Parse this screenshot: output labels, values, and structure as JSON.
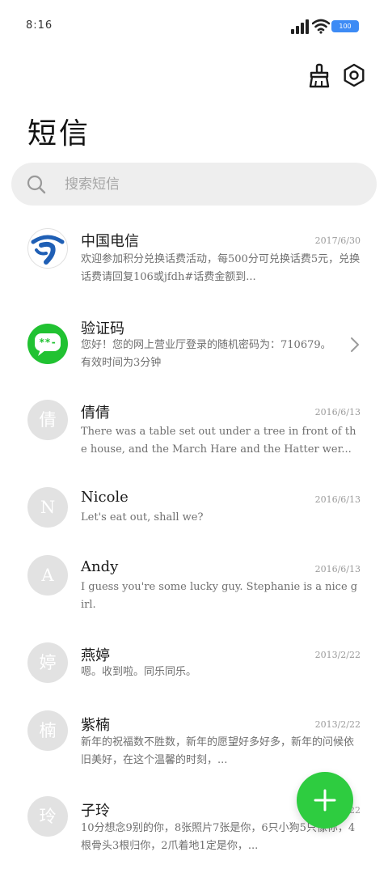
{
  "status_bar": {
    "time": "8:16",
    "battery": "100"
  },
  "header": {
    "title": "短信"
  },
  "search": {
    "placeholder": "搜索短信"
  },
  "messages": [
    {
      "name": "中国电信",
      "date": "2017/6/30",
      "preview": "欢迎参加积分兑换话费活动，每500分可兑换话费5元，兑换话费请回复106或jfdh#话费金额到...",
      "avatar_type": "logo-telecom"
    },
    {
      "name": "验证码",
      "date": "",
      "preview": "您好！您的网上营业厅登录的随机密码为：710679。有效时间为3分钟",
      "avatar_type": "logo-code",
      "avatar_text": "**-"
    },
    {
      "name": "倩倩",
      "date": "2016/6/13",
      "preview": "There was a table set out under a tree in front of the house, and the March Hare and the Hatter wer...",
      "avatar_text": "倩"
    },
    {
      "name": "Nicole",
      "date": "2016/6/13",
      "preview": "Let's eat out, shall we?",
      "avatar_text": "N"
    },
    {
      "name": "Andy",
      "date": "2016/6/13",
      "preview": "I guess you're some lucky guy. Stephanie is a nice girl.",
      "avatar_text": "A"
    },
    {
      "name": "燕婷",
      "date": "2013/2/22",
      "preview": "嗯。收到啦。同乐同乐。",
      "avatar_text": "婷"
    },
    {
      "name": "紫楠",
      "date": "2013/2/22",
      "preview": "新年的祝福数不胜数，新年的愿望好多好多，新年的问候依旧美好，在这个温馨的时刻，...",
      "avatar_text": "楠"
    },
    {
      "name": "子玲",
      "date": "2013/2/22",
      "preview": "10分想念9别的你，8张照片7张是你，6只小狗5只像你，4根骨头3根归你，2爪着地1定是你，...",
      "avatar_text": "玲"
    }
  ],
  "colors": {
    "accent": "#2ecc40",
    "avatar_bg": "#e2e2e2",
    "search_bg": "#eeeeee",
    "battery": "#3d8bf5"
  },
  "icons": {
    "broom": "broom-icon",
    "settings": "settings-icon",
    "search": "search-icon",
    "add": "plus-icon"
  }
}
